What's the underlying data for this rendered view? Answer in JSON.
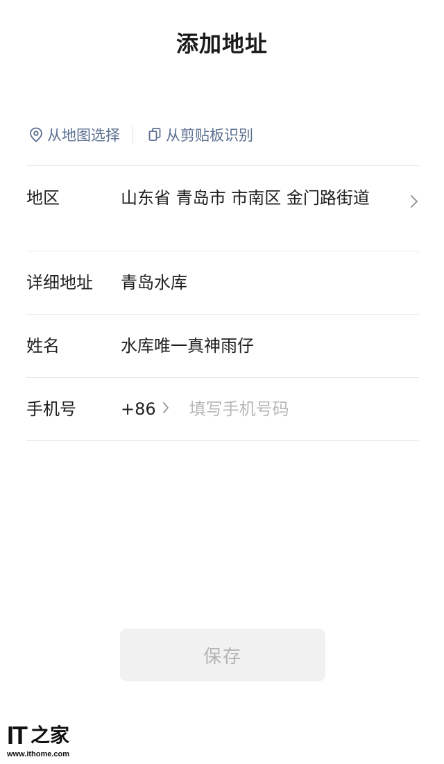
{
  "header": {
    "title": "添加地址"
  },
  "quick_actions": {
    "from_map": {
      "label": "从地图选择",
      "icon": "location-pin-icon"
    },
    "from_clipboard": {
      "label": "从剪贴板识别",
      "icon": "copy-icon"
    }
  },
  "form": {
    "region": {
      "label": "地区",
      "value": "山东省 青岛市 市南区 金门路街道"
    },
    "detail_address": {
      "label": "详细地址",
      "value": "青岛水库"
    },
    "name": {
      "label": "姓名",
      "value": "水库唯一真神雨仔"
    },
    "phone": {
      "label": "手机号",
      "country_code": "+86",
      "value": "",
      "placeholder": "填写手机号码"
    }
  },
  "actions": {
    "save_label": "保存"
  },
  "watermark": {
    "logo_text": "IT",
    "logo_hanzi": "之家",
    "url": "www.ithome.com"
  },
  "colors": {
    "link": "#5a6e90",
    "divider": "#e8e8e8",
    "placeholder": "#b8b8b8",
    "save_bg": "#f1f1f1",
    "save_text": "#b4b4b4"
  }
}
